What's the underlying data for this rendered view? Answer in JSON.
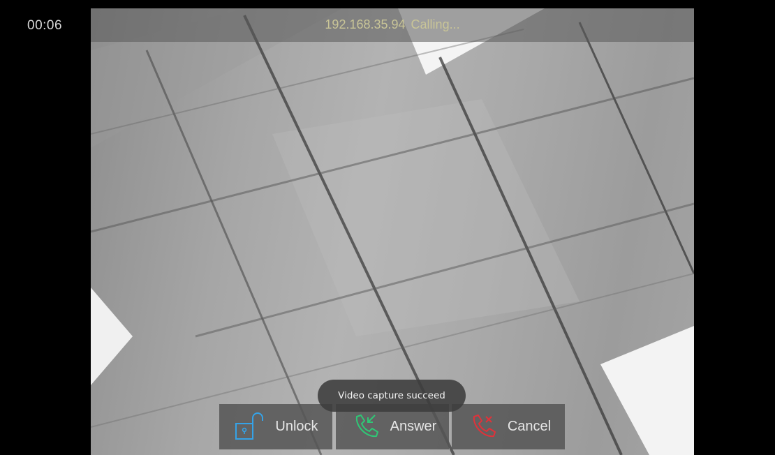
{
  "call": {
    "timer": "00:06",
    "caller_ip": "192.168.35.94",
    "status": "Calling..."
  },
  "toast": {
    "message": "Video capture succeed"
  },
  "actions": {
    "unlock_label": "Unlock",
    "answer_label": "Answer",
    "cancel_label": "Cancel"
  },
  "colors": {
    "unlock_icon": "#35a3e8",
    "answer_icon": "#2fc776",
    "cancel_icon": "#e0323a",
    "caller_text": "#c9c597"
  },
  "icons": {
    "unlock": "unlock-icon",
    "answer": "answer-phone-icon",
    "cancel": "hangup-phone-icon"
  }
}
